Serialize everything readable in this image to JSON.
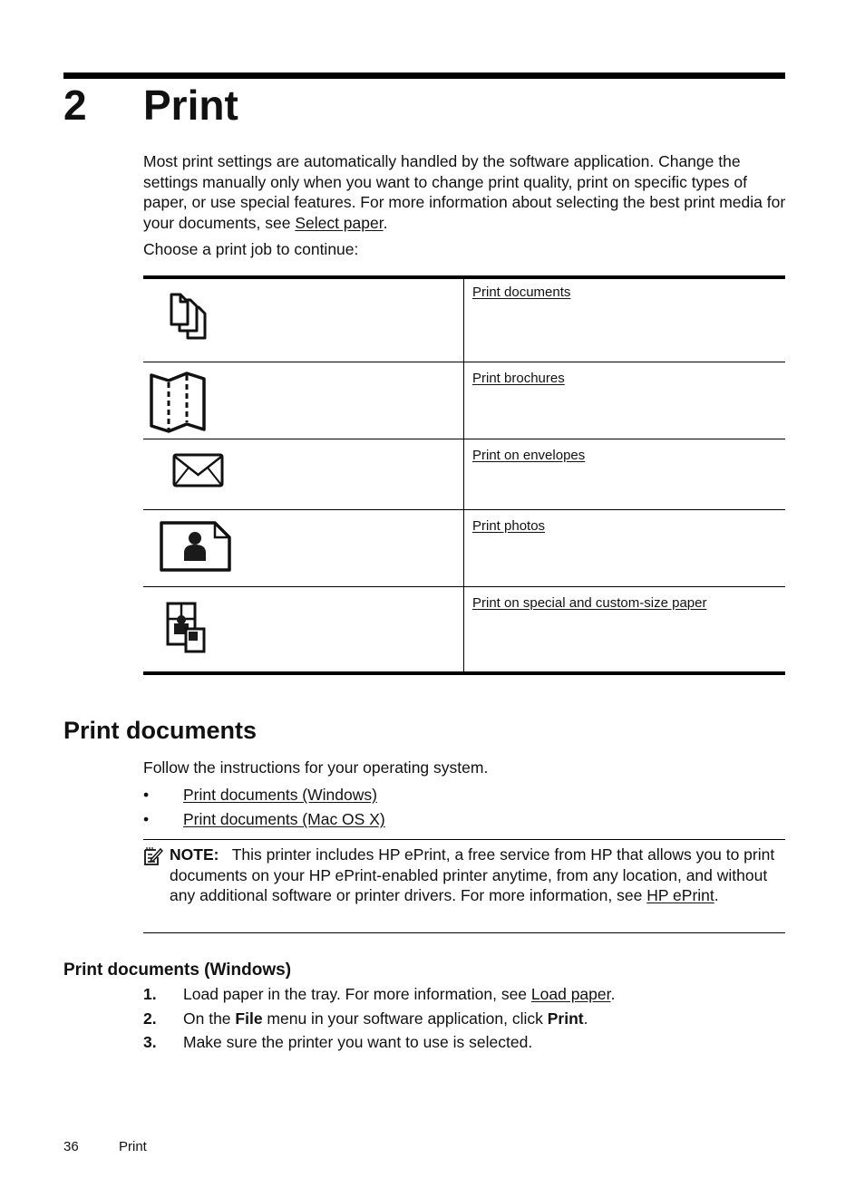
{
  "chapter": {
    "number": "2",
    "title": "Print"
  },
  "intro": {
    "text_before_link": "Most print settings are automatically handled by the software application. Change the settings manually only when you want to change print quality, print on specific types of paper, or use special features. For more information about selecting the best print media for your documents, see ",
    "link": "Select paper",
    "text_after_link": ".",
    "choose": "Choose a print job to continue:"
  },
  "print_jobs": [
    {
      "icon": "documents-icon",
      "label": "Print documents"
    },
    {
      "icon": "brochure-icon",
      "label": "Print brochures"
    },
    {
      "icon": "envelope-icon",
      "label": "Print on envelopes"
    },
    {
      "icon": "photo-icon",
      "label": "Print photos"
    },
    {
      "icon": "custom-paper-icon",
      "label": "Print on special and custom-size paper"
    }
  ],
  "section": {
    "title": "Print documents",
    "follow": "Follow the instructions for your operating system.",
    "bullet_glyph": "•",
    "links": [
      "Print documents (Windows)",
      "Print documents (Mac OS X)"
    ]
  },
  "note": {
    "icon": "note-icon",
    "label": "NOTE:",
    "text_before_link": "This printer includes HP ePrint, a free service from HP that allows you to print documents on your HP ePrint-enabled printer anytime, from any location, and without any additional software or printer drivers. For more information, see ",
    "link": "HP ePrint",
    "text_after_link": "."
  },
  "windows": {
    "title": "Print documents (Windows)",
    "steps": [
      {
        "num": "1.",
        "before": "Load paper in the tray. For more information, see ",
        "link": "Load paper",
        "after": "."
      },
      {
        "num": "2.",
        "p1": "On the ",
        "b1": "File",
        "p2": " menu in your software application, click ",
        "b2": "Print",
        "p3": "."
      },
      {
        "num": "3.",
        "text": "Make sure the printer you want to use is selected."
      }
    ]
  },
  "footer": {
    "page_number": "36",
    "section_label": "Print"
  }
}
